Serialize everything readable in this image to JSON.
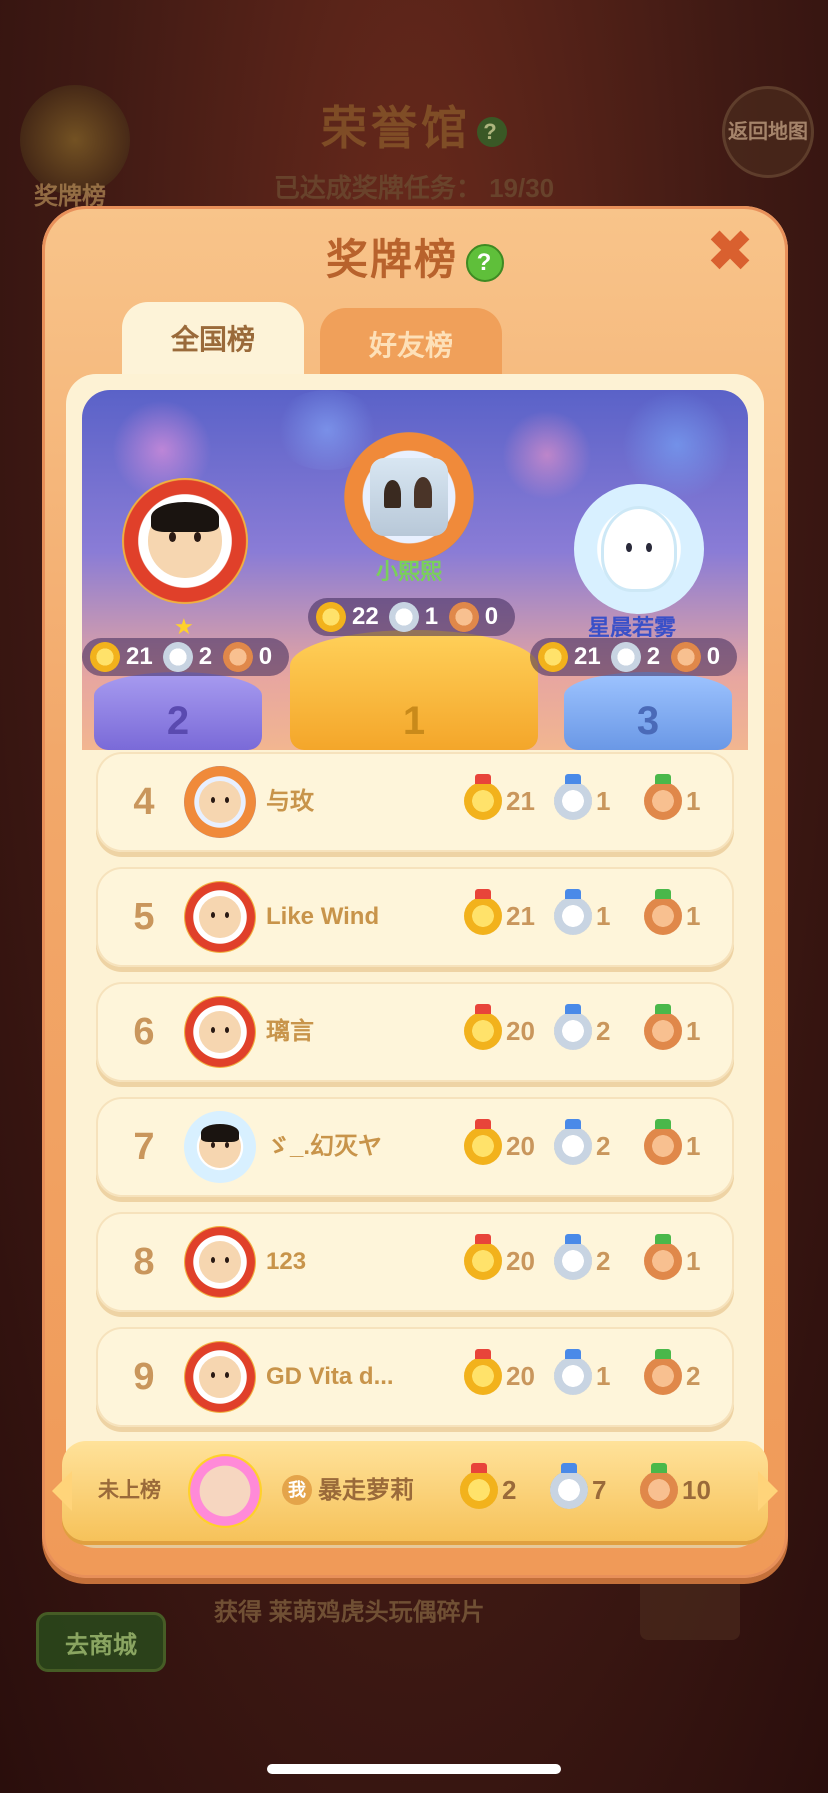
{
  "background": {
    "title": "荣誉馆",
    "progress_label": "已达成奖牌任务：",
    "progress_value": "19/30",
    "medal_board_label": "奖牌榜",
    "back_label": "返回地图",
    "shop_label": "去商城",
    "reward_text": "获得 莱萌鸡虎头玩偶碎片"
  },
  "modal": {
    "title": "奖牌榜",
    "tabs": [
      {
        "label": "全国榜",
        "active": true
      },
      {
        "label": "好友榜",
        "active": false
      }
    ]
  },
  "podium": [
    {
      "rank": 1,
      "stage_label": "1",
      "name": "小熙熙",
      "name_color": "#7ad05a",
      "gold": 22,
      "silver": 1,
      "bronze": 0
    },
    {
      "rank": 2,
      "stage_label": "2",
      "name": "",
      "gold": 21,
      "silver": 2,
      "bronze": 0
    },
    {
      "rank": 3,
      "stage_label": "3",
      "name": "星晨若雾",
      "name_color": "#3a50c8",
      "gold": 21,
      "silver": 2,
      "bronze": 0
    }
  ],
  "rows": [
    {
      "rank": "4",
      "name": "与玫",
      "gold": 21,
      "silver": 1,
      "bronze": 1
    },
    {
      "rank": "5",
      "name": "Like Wind",
      "gold": 21,
      "silver": 1,
      "bronze": 1
    },
    {
      "rank": "6",
      "name": "璃言",
      "gold": 20,
      "silver": 2,
      "bronze": 1
    },
    {
      "rank": "7",
      "name": "ゞ_.幻灭ヤ",
      "gold": 20,
      "silver": 2,
      "bronze": 1
    },
    {
      "rank": "8",
      "name": "123",
      "gold": 20,
      "silver": 2,
      "bronze": 1
    },
    {
      "rank": "9",
      "name": "GD Vita d...",
      "gold": 20,
      "silver": 1,
      "bronze": 2
    }
  ],
  "me": {
    "status": "未上榜",
    "badge": "我",
    "name": "暴走萝莉",
    "gold": 2,
    "silver": 7,
    "bronze": 10
  },
  "colors": {
    "gold_medal": "#f2b21c",
    "silver_medal": "#c8d4e2",
    "bronze_medal": "#e0884a",
    "panel": "#fdf2d4",
    "modal": "#f2a86a"
  }
}
